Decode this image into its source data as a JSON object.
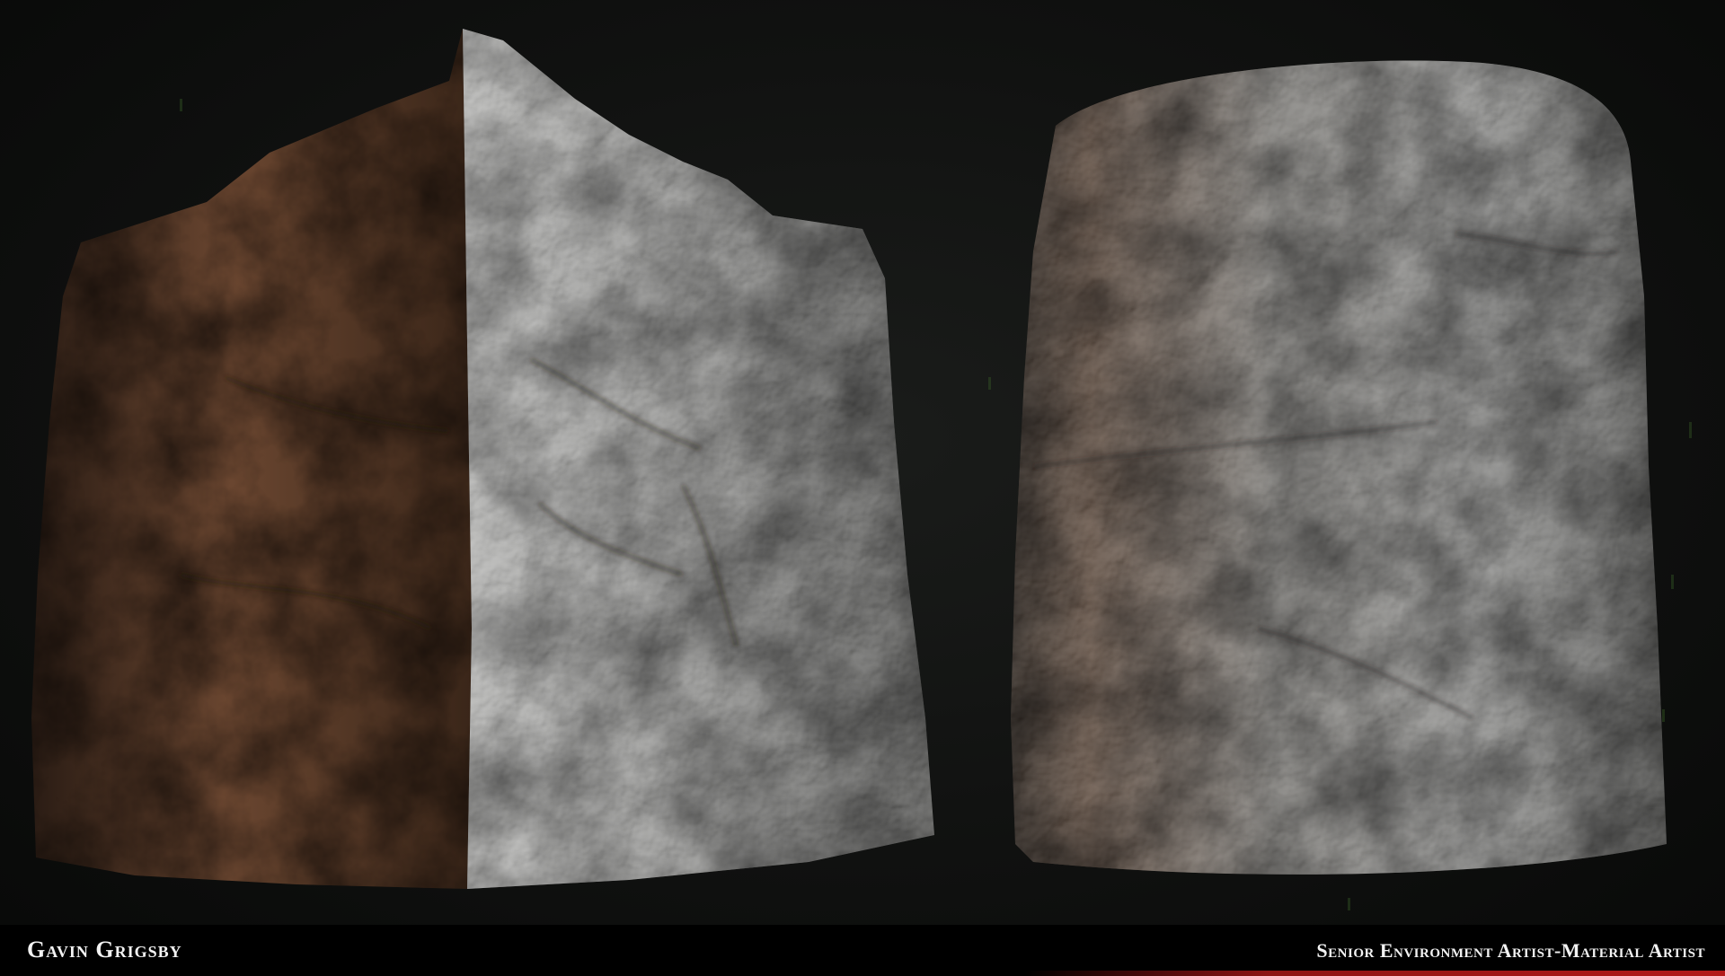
{
  "footer": {
    "artist_name": "Gavin Grigsby",
    "artist_title": "Senior Environment Artist-Material Artist",
    "accent_color": "#b31a1a"
  },
  "scene": {
    "background_color": "#0d0e0d",
    "objects": [
      {
        "shape": "cube",
        "material": "rough rock",
        "warm_side_color": "#6a4630",
        "lit_side_color": "#9a9a98"
      },
      {
        "shape": "cylinder",
        "material": "rough rock",
        "warm_side_color": "#5a4638",
        "lit_side_color": "#8e8e8c"
      }
    ]
  }
}
